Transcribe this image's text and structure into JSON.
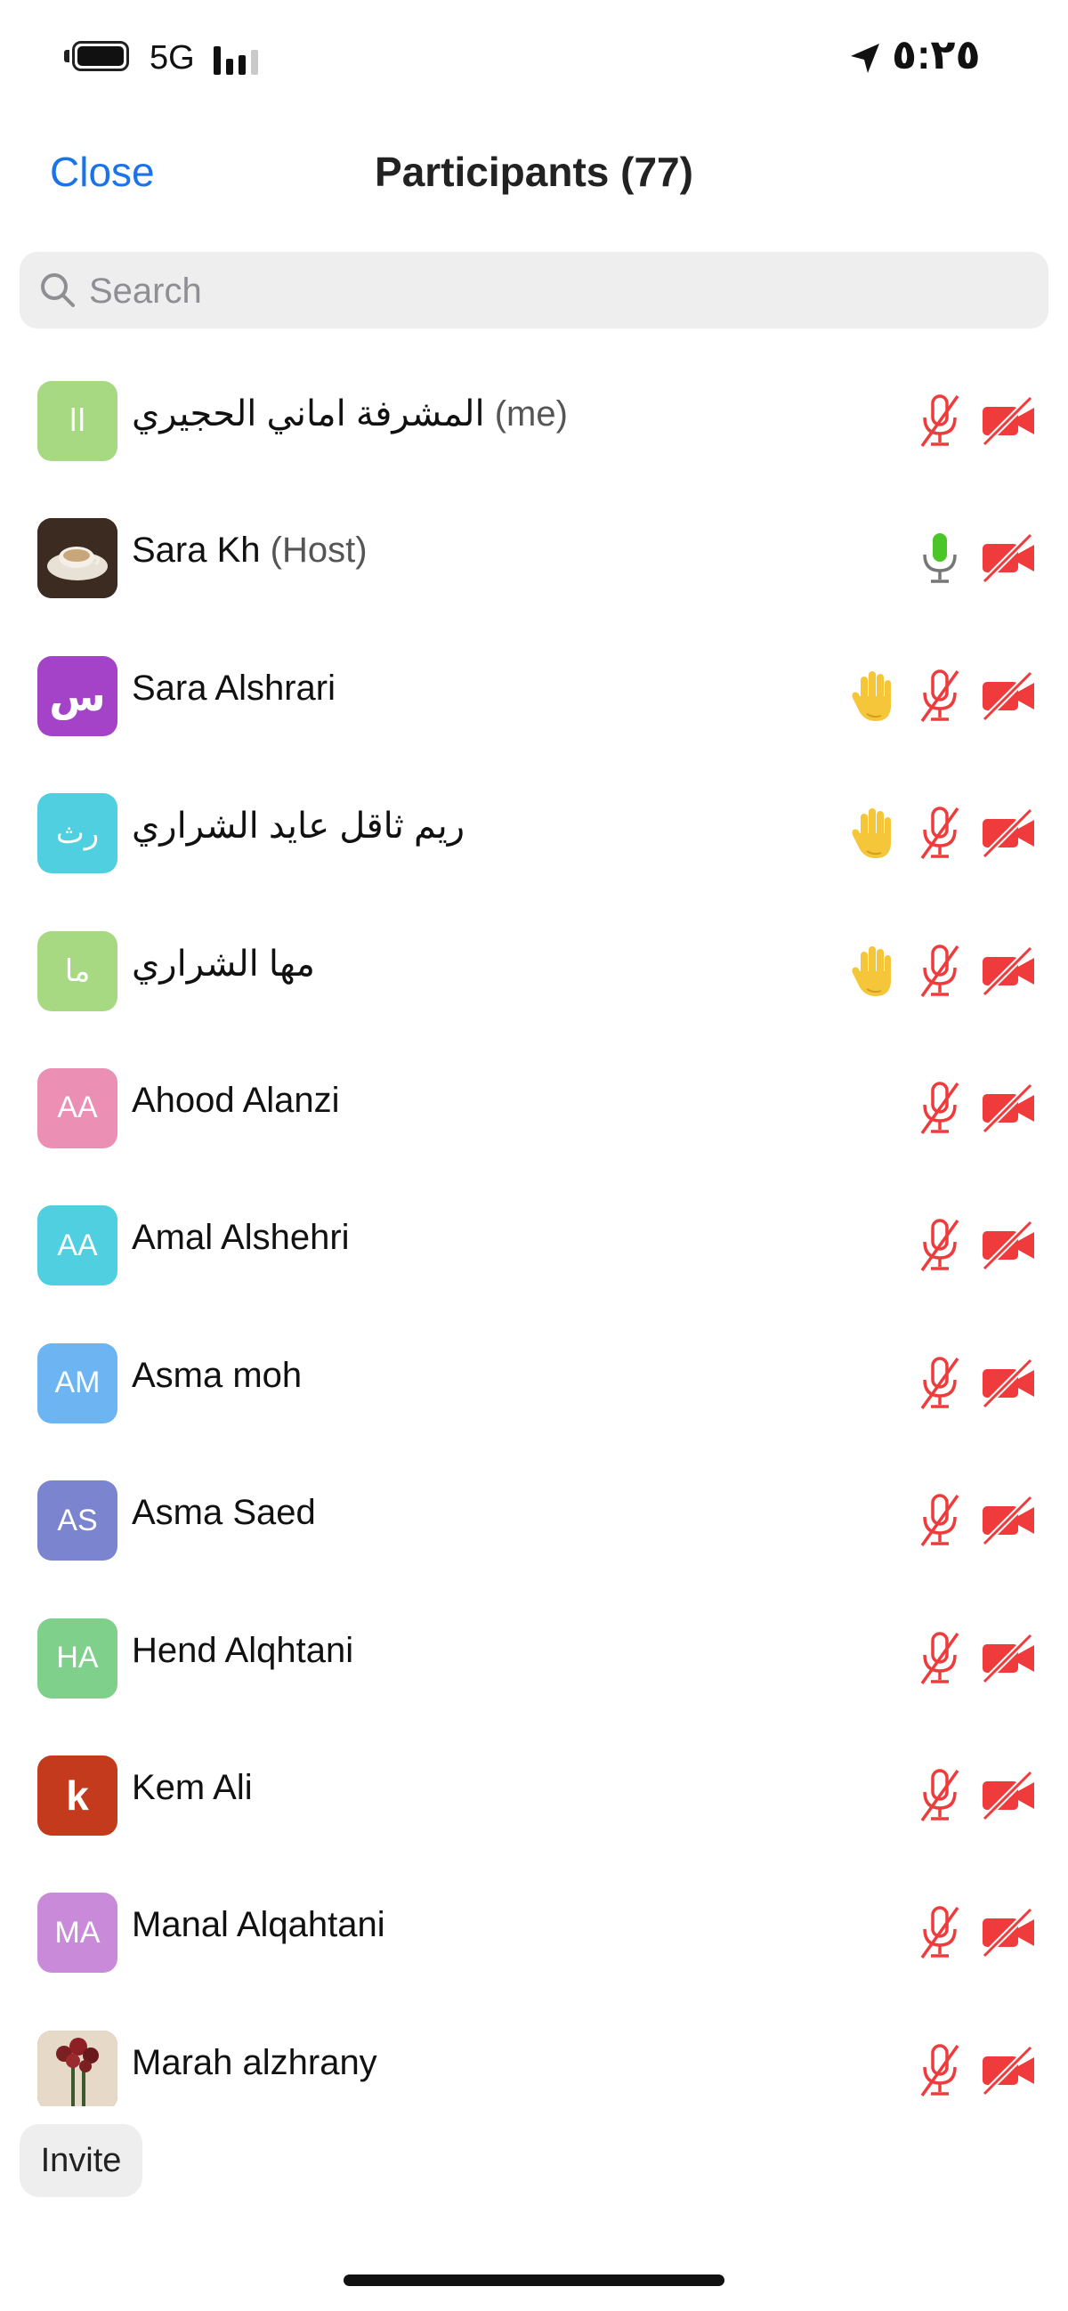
{
  "status": {
    "network": "5G",
    "time": "٥:٢٥"
  },
  "nav": {
    "close_label": "Close",
    "title": "Participants (77)"
  },
  "search": {
    "placeholder": "Search"
  },
  "participants": [
    {
      "name": "المشرفة اماني الحجيري",
      "tag": "(me)",
      "initials": "اا",
      "color": "#a7d983",
      "hand": false,
      "mic": "muted",
      "video": "off"
    },
    {
      "name": "Sara Kh",
      "tag": "(Host)",
      "initials": "",
      "color": "#4b3a2c",
      "photo": true,
      "hand": false,
      "mic": "on",
      "video": "off"
    },
    {
      "name": "Sara Alshrari",
      "tag": "",
      "initials": "س",
      "color": "#a543c8",
      "big": true,
      "hand": true,
      "mic": "muted",
      "video": "off"
    },
    {
      "name": "ريم ثاقل عايد الشراري",
      "tag": "",
      "initials": "رث",
      "color": "#4fcfe0",
      "hand": true,
      "mic": "muted",
      "video": "off"
    },
    {
      "name": "مها الشراري",
      "tag": "",
      "initials": "ما",
      "color": "#a7d983",
      "hand": true,
      "mic": "muted",
      "video": "off"
    },
    {
      "name": "Ahood Alanzi",
      "tag": "",
      "initials": "AA",
      "color": "#ec8fb4",
      "hand": false,
      "mic": "muted",
      "video": "off"
    },
    {
      "name": "Amal Alshehri",
      "tag": "",
      "initials": "AA",
      "color": "#4fcfe0",
      "hand": false,
      "mic": "muted",
      "video": "off"
    },
    {
      "name": "Asma moh",
      "tag": "",
      "initials": "AM",
      "color": "#6cb5f2",
      "hand": false,
      "mic": "muted",
      "video": "off"
    },
    {
      "name": "Asma Saed",
      "tag": "",
      "initials": "AS",
      "color": "#7b85cf",
      "hand": false,
      "mic": "muted",
      "video": "off"
    },
    {
      "name": "Hend Alqhtani",
      "tag": "",
      "initials": "HA",
      "color": "#7ed08b",
      "hand": false,
      "mic": "muted",
      "video": "off"
    },
    {
      "name": "Kem Ali",
      "tag": "",
      "initials": "k",
      "color": "#c43a1c",
      "big": true,
      "hand": false,
      "mic": "muted",
      "video": "off"
    },
    {
      "name": "Manal Alqahtani",
      "tag": "",
      "initials": "MA",
      "color": "#c98ad9",
      "hand": false,
      "mic": "muted",
      "video": "off"
    },
    {
      "name": "Marah alzhrany",
      "tag": "",
      "initials": "",
      "color": "#8a6b55",
      "photo": true,
      "hand": false,
      "mic": "muted",
      "video": "off"
    }
  ],
  "invite_label": "Invite",
  "colors": {
    "accent": "#1a73e8",
    "muted_red": "#ef3b3b",
    "mic_on_green": "#4cc52a",
    "hand_yellow": "#f6c63a"
  },
  "icons": {
    "hand": "raised-hand-icon",
    "mic_muted": "mic-muted-icon",
    "mic_on": "mic-icon",
    "video_off": "video-off-icon"
  }
}
